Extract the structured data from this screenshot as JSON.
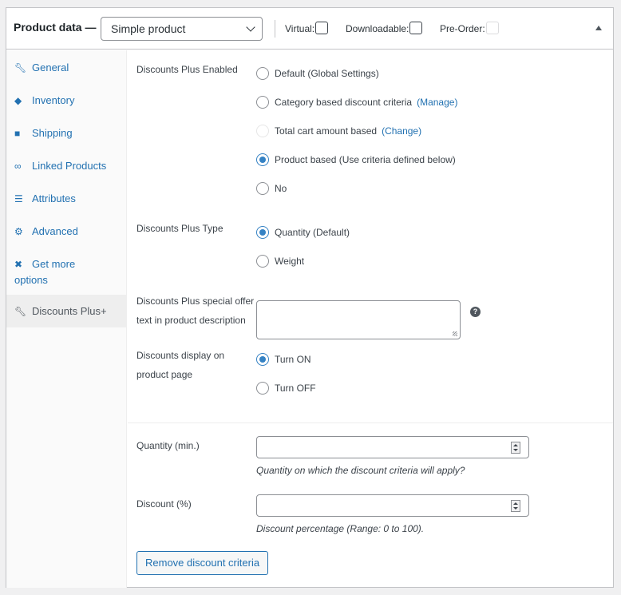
{
  "header": {
    "title": "Product data —",
    "product_type": "Simple product",
    "virtual_label": "Virtual:",
    "downloadable_label": "Downloadable:",
    "preorder_label": "Pre-Order:"
  },
  "sidebar": {
    "items": [
      {
        "label": "General",
        "icon": "wrench-icon"
      },
      {
        "label": "Inventory",
        "icon": "tag-icon"
      },
      {
        "label": "Shipping",
        "icon": "truck-icon"
      },
      {
        "label": "Linked Products",
        "icon": "link-icon"
      },
      {
        "label": "Attributes",
        "icon": "list-icon"
      },
      {
        "label": "Advanced",
        "icon": "gear-icon"
      },
      {
        "label": "Get more",
        "label2": "options",
        "icon": "plugin-icon"
      },
      {
        "label": "Discounts Plus+",
        "icon": "wrench-icon"
      }
    ]
  },
  "form": {
    "enabled": {
      "label": "Discounts Plus Enabled",
      "options": [
        {
          "label": "Default (Global Settings)"
        },
        {
          "label": "Category based discount criteria",
          "link": "(Manage)"
        },
        {
          "label": "Total cart amount based",
          "link": "(Change)"
        },
        {
          "label": "Product based (Use criteria defined below)"
        },
        {
          "label": "No"
        }
      ]
    },
    "type": {
      "label": "Discounts Plus Type",
      "options": [
        {
          "label": "Quantity (Default)"
        },
        {
          "label": "Weight"
        }
      ]
    },
    "special_offer": {
      "label_line1": "Discounts Plus special offer",
      "label_line2": "text in product description",
      "help": "?"
    },
    "display": {
      "label_line1": "Discounts display on",
      "label_line2": "product page",
      "options": [
        {
          "label": "Turn ON"
        },
        {
          "label": "Turn OFF"
        }
      ]
    },
    "quantity": {
      "label": "Quantity (min.)",
      "description": "Quantity on which the discount criteria will apply?"
    },
    "discount": {
      "label": "Discount (%)",
      "description": "Discount percentage (Range: 0 to 100)."
    },
    "remove_button": "Remove discount criteria"
  }
}
